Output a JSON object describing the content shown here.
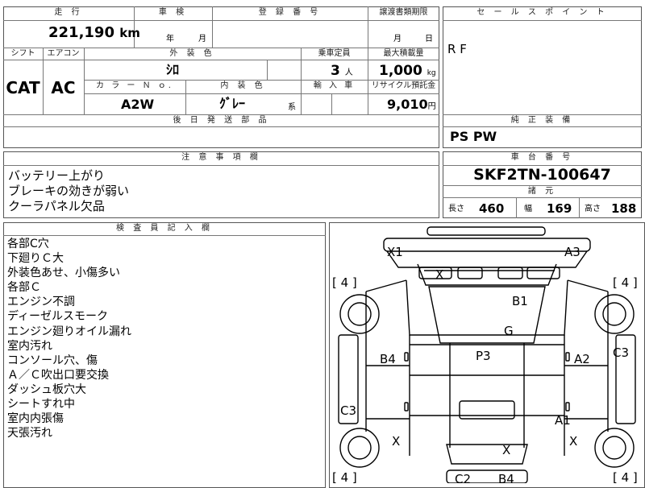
{
  "header": {
    "mileage_h": "走 行",
    "inspection_h": "車 検",
    "registration_h": "登 録 番 号",
    "transfer_h": "譲渡書類期限",
    "sales_h": "セ ー ル ス ポ イ ン ト",
    "shift_h": "シフト",
    "ac_h": "エアコン",
    "exterior_h": "外 装 色",
    "capacity_h": "乗車定員",
    "load_h": "最大積載量",
    "color_no_h": "カ ラ ー Ｎ ｏ.",
    "interior_h": "内 装 色",
    "import_h": "輸 入 車",
    "recycle_h": "リサイクル預託金",
    "parts_h": "後 日 発 送 部 品",
    "equip_h": "純 正 装 備",
    "notes_h": "注 意 事 項 欄",
    "chassis_h": "車 台 番 号",
    "spec_h": "諸 元",
    "inspector_h": "検 査 員 記 入 欄"
  },
  "values": {
    "mileage": "221,190",
    "mileage_unit": "km",
    "year_label": "年",
    "month_label": "月",
    "transfer_month": "月",
    "transfer_day": "日",
    "shift": "CAT",
    "ac": "AC",
    "exterior_color": "ｼﾛ",
    "capacity": "3",
    "capacity_unit": "人",
    "load": "1,000",
    "load_unit": "kg",
    "color_no": "A2W",
    "interior_color": "ｸﾞﾚｰ",
    "interior_suffix": "系",
    "recycle": "9,010",
    "recycle_unit": "円",
    "sales_point": "R F",
    "equipment": "PS  PW",
    "chassis_no": "SKF2TN-100647",
    "len_label": "長さ",
    "length": "460",
    "wid_label": "幅",
    "width": "169",
    "hgt_label": "高さ",
    "height": "188"
  },
  "notes": [
    "バッテリー上がり",
    "ブレーキの効きが弱い",
    "クーラパネル欠品"
  ],
  "inspector_notes": [
    "各部C穴",
    "下廻りＣ大",
    "外装色あせ、小傷多い",
    "各部Ｃ",
    "エンジン不調",
    "ディーゼルスモーク",
    "エンジン廻りオイル漏れ",
    "室内汚れ",
    "コンソール穴、傷",
    "Ａ／Ｃ吹出口要交換",
    "ダッシュ板穴大",
    "シートすれ中",
    "室内内張傷",
    "天張汚れ"
  ],
  "diagram_labels": {
    "x1": "X1",
    "a3": "A3",
    "x_top": "X",
    "b1": "B1",
    "g": "G",
    "p3": "P3",
    "b4": "B4",
    "a2": "A2",
    "c3_right": "C3",
    "c3_left": "C3",
    "a1": "A1",
    "x_left": "X",
    "x_center": "X",
    "x_right": "X",
    "tyre_tl": "[ 4 ]",
    "tyre_tr": "[ 4 ]",
    "tyre_bl": "[ 4 ]",
    "tyre_br": "[ 4 ]",
    "c2": "C2",
    "b4_bottom": "B4"
  }
}
